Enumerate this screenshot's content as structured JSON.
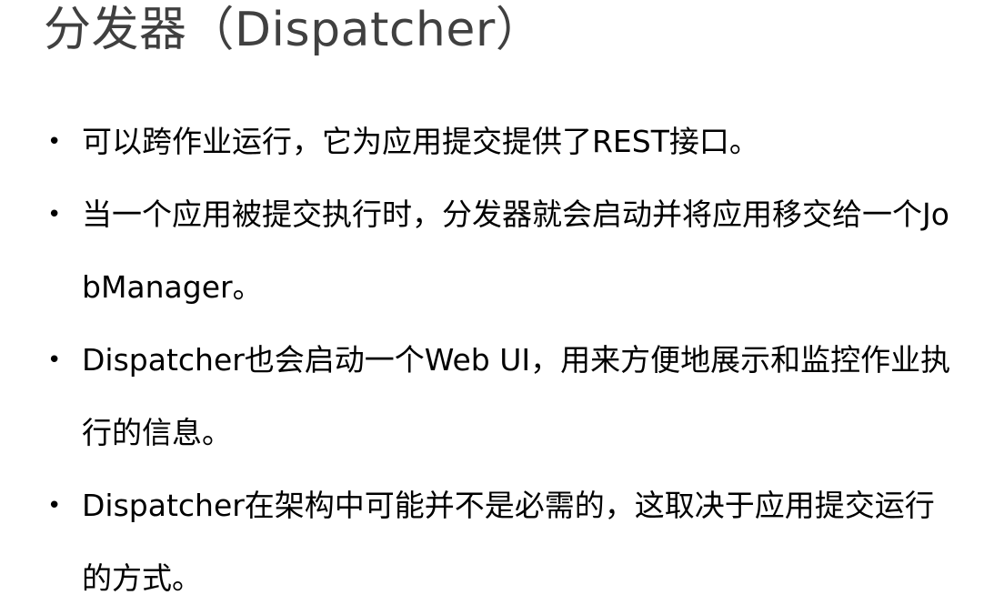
{
  "slide": {
    "title": "分发器（Dispatcher）",
    "bullets": [
      {
        "text": "可以跨作业运行，它为应用提交提供了REST接口。"
      },
      {
        "text": "当一个应用被提交执行时，分发器就会启动并将应用移交给一个JobManager。"
      },
      {
        "text": "Dispatcher也会启动一个Web UI，用来方便地展示和监控作业执行的信息。"
      },
      {
        "text": "Dispatcher在架构中可能并不是必需的，这取决于应用提交运行的方式。"
      }
    ],
    "bullet_marker": "•"
  }
}
